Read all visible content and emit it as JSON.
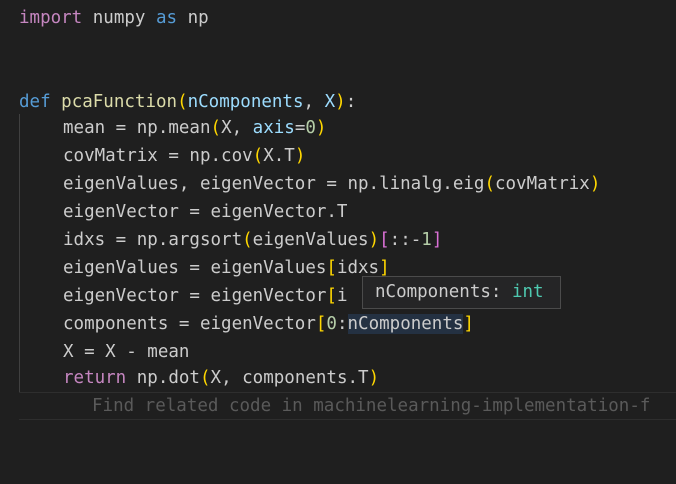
{
  "editor": {
    "language": "python",
    "colors": {
      "background": "#1f1f1f",
      "keyword": "#569cd6",
      "import_keyword": "#c586c0",
      "function": "#dcdcaa",
      "parameter": "#9cdcfe",
      "number": "#b5cea8",
      "bracket": "#ffd700",
      "type": "#4ec9b0"
    },
    "lines": {
      "l1": {
        "import": "import",
        "module": "numpy",
        "as": "as",
        "alias": "np"
      },
      "l4": {
        "def": "def",
        "fname": "pcaFunction",
        "p1": "nComponents",
        "comma": ", ",
        "p2": "X",
        "colon": ":"
      },
      "l5": {
        "lhs": "mean = np.mean",
        "arg": "X, ",
        "kw": "axis",
        "eq": "=",
        "num": "0"
      },
      "l6": {
        "lhs": "covMatrix = np.cov",
        "arg": "X.T"
      },
      "l7": {
        "lhs": "eigenValues, eigenVector = np.linalg.eig",
        "arg": "covMatrix"
      },
      "l8": {
        "text": "eigenVector = eigenVector.T"
      },
      "l9": {
        "lhs": "idxs = np.argsort",
        "arg": "eigenValues",
        "mid": "::-",
        "num": "1"
      },
      "l10": {
        "lhs": "eigenValues = eigenValues",
        "arg": "idxs"
      },
      "l11": {
        "lhs": "eigenVector = eigenVector",
        "arg": "i"
      },
      "l12": {
        "lhs": "components = eigenVector",
        "num": "0",
        "colon": ":",
        "arg": "nComponents"
      },
      "l13": {
        "text": "X = X - mean"
      },
      "l14": {
        "ret": "return",
        "lhs": " np.dot",
        "arg": "X, components.T"
      }
    },
    "ghost_text": "Find related code in machinelearning-implementation-f"
  },
  "hover": {
    "name": "nComponents",
    "sep": ": ",
    "type": "int"
  }
}
